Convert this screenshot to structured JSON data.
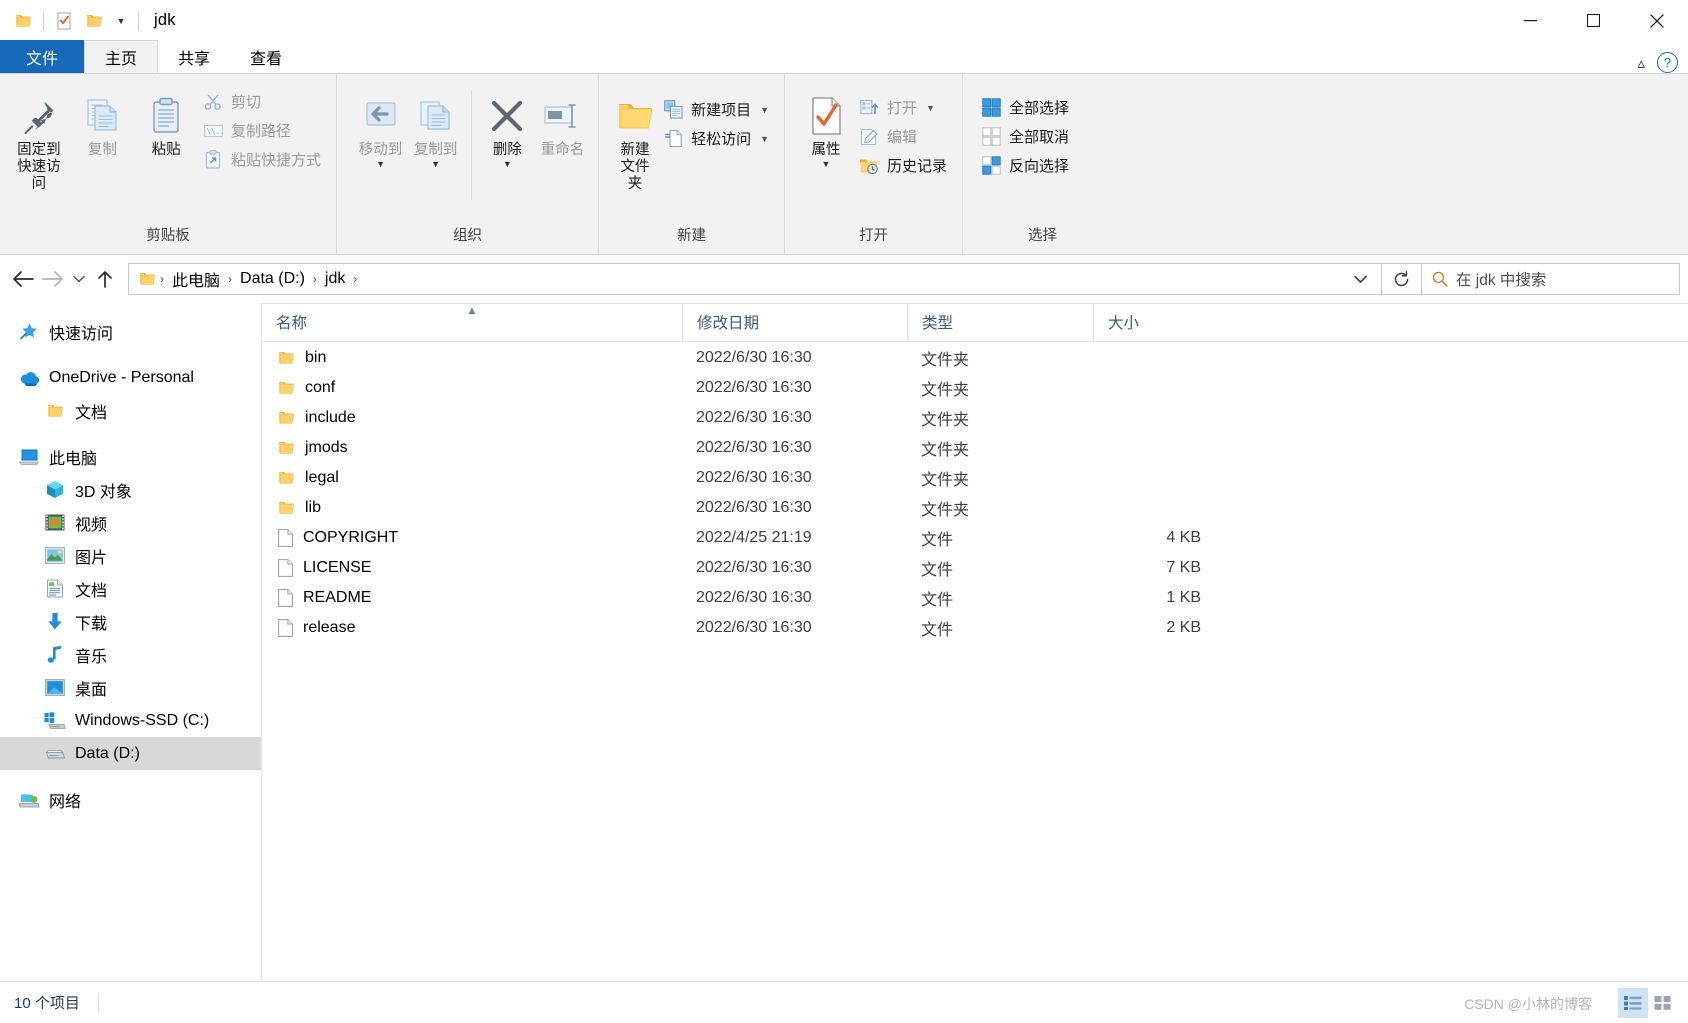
{
  "window": {
    "title": "jdk",
    "quick_access_icons": [
      "folder-icon",
      "checklist-icon",
      "folder-icon"
    ],
    "caption": {
      "minimize": "—",
      "maximize": "☐",
      "close": "✕"
    }
  },
  "tabs": [
    {
      "label": "文件",
      "name": "tab-file",
      "state": "file-menu"
    },
    {
      "label": "主页",
      "name": "tab-home",
      "state": "active"
    },
    {
      "label": "共享",
      "name": "tab-share",
      "state": "normal"
    },
    {
      "label": "查看",
      "name": "tab-view",
      "state": "normal"
    }
  ],
  "ribbon": {
    "groups": [
      {
        "label": "剪贴板",
        "name": "group-clipboard",
        "big": [
          {
            "label": "固定到快速访问",
            "icon": "pin-icon",
            "disabled": false
          },
          {
            "label": "复制",
            "icon": "copy-icon",
            "disabled": true
          },
          {
            "label": "粘贴",
            "icon": "paste-icon",
            "disabled": false
          }
        ],
        "small": [
          {
            "label": "剪切",
            "icon": "scissors-icon",
            "disabled": true
          },
          {
            "label": "复制路径",
            "icon": "copy-path-icon",
            "disabled": true
          },
          {
            "label": "粘贴快捷方式",
            "icon": "paste-shortcut-icon",
            "disabled": true
          }
        ]
      },
      {
        "label": "组织",
        "name": "group-organize",
        "big": [
          {
            "label": "移动到",
            "icon": "move-to-icon",
            "disabled": true,
            "caret": true
          },
          {
            "label": "复制到",
            "icon": "copy-to-icon",
            "disabled": true,
            "caret": true
          },
          {
            "label": "删除",
            "icon": "delete-x-icon",
            "disabled": false,
            "caret": true
          },
          {
            "label": "重命名",
            "icon": "rename-icon",
            "disabled": true
          }
        ],
        "small": []
      },
      {
        "label": "新建",
        "name": "group-new",
        "big": [
          {
            "label": "新建文件夹",
            "icon": "new-folder-icon",
            "disabled": false
          }
        ],
        "small": [
          {
            "label": "新建项目",
            "icon": "new-item-icon",
            "disabled": false,
            "caret": true
          },
          {
            "label": "轻松访问",
            "icon": "easy-access-icon",
            "disabled": false,
            "caret": true
          }
        ]
      },
      {
        "label": "打开",
        "name": "group-open",
        "big": [
          {
            "label": "属性",
            "icon": "properties-icon",
            "disabled": false,
            "caret": true
          }
        ],
        "small": [
          {
            "label": "打开",
            "icon": "open-icon",
            "disabled": true,
            "caret": true
          },
          {
            "label": "编辑",
            "icon": "edit-icon",
            "disabled": true
          },
          {
            "label": "历史记录",
            "icon": "history-icon",
            "disabled": false
          }
        ]
      },
      {
        "label": "选择",
        "name": "group-select",
        "big": [],
        "small": [
          {
            "label": "全部选择",
            "icon": "select-all-icon",
            "disabled": false
          },
          {
            "label": "全部取消",
            "icon": "select-none-icon",
            "disabled": false
          },
          {
            "label": "反向选择",
            "icon": "invert-selection-icon",
            "disabled": false
          }
        ]
      }
    ]
  },
  "address": {
    "back": "←",
    "forward": "→",
    "recent": "⌄",
    "up": "↑",
    "breadcrumbs": [
      "此电脑",
      "Data (D:)",
      "jdk"
    ],
    "separator": "›",
    "refresh": "↻"
  },
  "search": {
    "placeholder": "在 jdk 中搜索",
    "value": ""
  },
  "sidebar": {
    "items": [
      {
        "label": "快速访问",
        "icon": "star-pin-icon",
        "indent": 0,
        "selected": false,
        "gap_after": true
      },
      {
        "label": "OneDrive - Personal",
        "icon": "onedrive-cloud-icon",
        "indent": 0,
        "selected": false
      },
      {
        "label": "文档",
        "icon": "folder-icon",
        "indent": 1,
        "selected": false,
        "gap_after": true
      },
      {
        "label": "此电脑",
        "icon": "this-pc-icon",
        "indent": 0,
        "selected": false
      },
      {
        "label": "3D 对象",
        "icon": "3d-objects-icon",
        "indent": 1,
        "selected": false
      },
      {
        "label": "视频",
        "icon": "videos-icon",
        "indent": 1,
        "selected": false
      },
      {
        "label": "图片",
        "icon": "pictures-icon",
        "indent": 1,
        "selected": false
      },
      {
        "label": "文档",
        "icon": "documents-icon",
        "indent": 1,
        "selected": false
      },
      {
        "label": "下载",
        "icon": "downloads-icon",
        "indent": 1,
        "selected": false
      },
      {
        "label": "音乐",
        "icon": "music-icon",
        "indent": 1,
        "selected": false
      },
      {
        "label": "桌面",
        "icon": "desktop-icon",
        "indent": 1,
        "selected": false
      },
      {
        "label": "Windows-SSD (C:)",
        "icon": "windows-drive-icon",
        "indent": 1,
        "selected": false
      },
      {
        "label": "Data (D:)",
        "icon": "drive-icon",
        "indent": 1,
        "selected": true,
        "gap_after": true
      },
      {
        "label": "网络",
        "icon": "network-icon",
        "indent": 0,
        "selected": false
      }
    ]
  },
  "filelist": {
    "columns": [
      {
        "label": "名称",
        "name": "column-name",
        "sorted": "asc"
      },
      {
        "label": "修改日期",
        "name": "column-date",
        "sorted": ""
      },
      {
        "label": "类型",
        "name": "column-type",
        "sorted": ""
      },
      {
        "label": "大小",
        "name": "column-size",
        "sorted": ""
      }
    ],
    "rows": [
      {
        "name": "bin",
        "date": "2022/6/30 16:30",
        "type": "文件夹",
        "size": "",
        "icon": "folder-icon"
      },
      {
        "name": "conf",
        "date": "2022/6/30 16:30",
        "type": "文件夹",
        "size": "",
        "icon": "folder-icon"
      },
      {
        "name": "include",
        "date": "2022/6/30 16:30",
        "type": "文件夹",
        "size": "",
        "icon": "folder-icon"
      },
      {
        "name": "jmods",
        "date": "2022/6/30 16:30",
        "type": "文件夹",
        "size": "",
        "icon": "folder-icon"
      },
      {
        "name": "legal",
        "date": "2022/6/30 16:30",
        "type": "文件夹",
        "size": "",
        "icon": "folder-icon"
      },
      {
        "name": "lib",
        "date": "2022/6/30 16:30",
        "type": "文件夹",
        "size": "",
        "icon": "folder-icon"
      },
      {
        "name": "COPYRIGHT",
        "date": "2022/4/25 21:19",
        "type": "文件",
        "size": "4 KB",
        "icon": "file-icon"
      },
      {
        "name": "LICENSE",
        "date": "2022/6/30 16:30",
        "type": "文件",
        "size": "7 KB",
        "icon": "file-icon"
      },
      {
        "name": "README",
        "date": "2022/6/30 16:30",
        "type": "文件",
        "size": "1 KB",
        "icon": "file-icon"
      },
      {
        "name": "release",
        "date": "2022/6/30 16:30",
        "type": "文件",
        "size": "2 KB",
        "icon": "file-icon"
      }
    ]
  },
  "status": {
    "item_count": "10 个项目",
    "watermark": "CSDN @小林的博客"
  },
  "colors": {
    "accent": "#1668b8",
    "folder": "#ffd076",
    "selection": "#d8d8d8",
    "ribbon_bg": "#f2f2f2",
    "header_text": "#3b5a7a"
  }
}
